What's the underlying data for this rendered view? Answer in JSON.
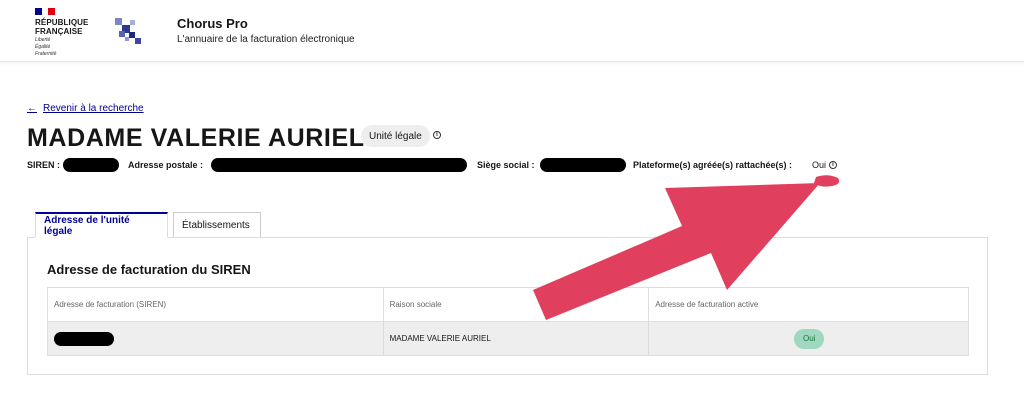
{
  "header": {
    "flag_colors": [
      "#000091",
      "#ffffff",
      "#e1000f"
    ],
    "rf_title_line1": "RÉPUBLIQUE",
    "rf_title_line2": "FRANÇAISE",
    "rf_motto_line1": "Liberté",
    "rf_motto_line2": "Égalité",
    "rf_motto_line3": "Fraternité",
    "service_name": "Chorus Pro",
    "service_tagline": "L'annuaire de la facturation électronique"
  },
  "back_link": {
    "icon": "arrow-left-icon",
    "label": "Revenir à la recherche"
  },
  "entity": {
    "name": "MADAME VALERIE AURIEL",
    "badge": "Unité légale"
  },
  "details": {
    "siren_label": "SIREN :",
    "address_label": "Adresse postale :",
    "seat_label": "Siège social :",
    "platform_label": "Plateforme(s) agréée(s) rattachée(s) :",
    "platform_value": "Oui"
  },
  "tabs": [
    {
      "label": "Adresse de l'unité légale",
      "active": true
    },
    {
      "label": "Établissements",
      "active": false
    }
  ],
  "panel": {
    "title": "Adresse de facturation du SIREN",
    "columns": [
      "Adresse de facturation (SIREN)",
      "Raison sociale",
      "Adresse de facturation active"
    ],
    "row": {
      "raison_sociale": "MADAME VALERIE AURIEL",
      "active": "Oui"
    }
  },
  "colors": {
    "accent": "#000091",
    "annotation": "#e0405e",
    "redaction": "#000000",
    "status_green_bg": "#9fd8bf"
  }
}
